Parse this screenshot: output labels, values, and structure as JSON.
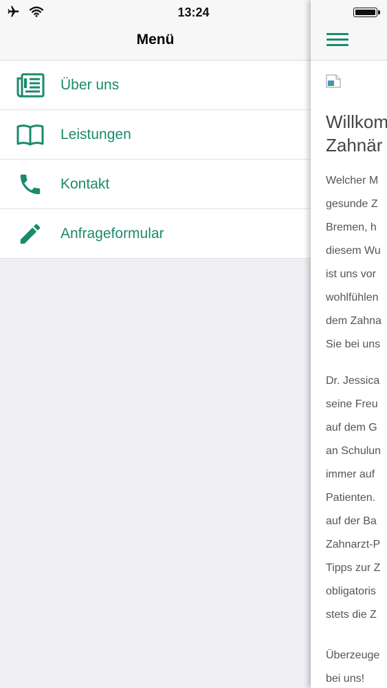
{
  "status_bar": {
    "time": "13:24"
  },
  "menu": {
    "title": "Menü",
    "items": [
      {
        "label": "Über uns",
        "icon": "newspaper-icon"
      },
      {
        "label": "Leistungen",
        "icon": "book-icon"
      },
      {
        "label": "Kontakt",
        "icon": "phone-icon"
      },
      {
        "label": "Anfrageformular",
        "icon": "pencil-icon"
      }
    ]
  },
  "content": {
    "heading_lines": [
      "Willkom",
      "Zahnär"
    ],
    "paragraph1_lines": [
      "Welcher M",
      "gesunde Z",
      "Bremen, h",
      "diesem Wu",
      "ist uns vor",
      "wohlfühlen",
      "dem Zahna",
      "Sie bei uns"
    ],
    "paragraph2_lines": [
      "Dr. Jessica",
      "seine Freu",
      "auf dem G",
      "an Schulun",
      "immer auf",
      "Patienten.",
      "auf der Ba",
      "Zahnarzt-P",
      "Tipps zur Z",
      "obligatoris",
      "stets die Z"
    ],
    "paragraph3_lines": [
      "Überzeuge",
      "bei uns!"
    ]
  },
  "colors": {
    "accent": "#1a8a6c"
  }
}
